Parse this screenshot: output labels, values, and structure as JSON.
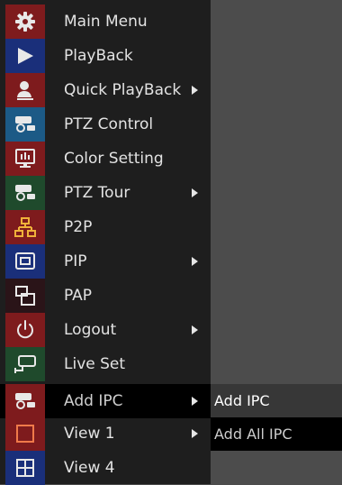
{
  "menu": {
    "items": [
      {
        "label": "Main Menu",
        "icon": "gear-icon",
        "icon_bg": "#7e1b1d",
        "has_submenu": false
      },
      {
        "label": "PlayBack",
        "icon": "play-icon",
        "icon_bg": "#1a2f7a",
        "has_submenu": false
      },
      {
        "label": "Quick PlayBack",
        "icon": "user-icon",
        "icon_bg": "#7e1b1d",
        "has_submenu": true
      },
      {
        "label": "PTZ Control",
        "icon": "ptz-camera-icon",
        "icon_bg": "#1c5a86",
        "has_submenu": false
      },
      {
        "label": "Color Setting",
        "icon": "monitor-icon",
        "icon_bg": "#7e1b1d",
        "has_submenu": false
      },
      {
        "label": "PTZ Tour",
        "icon": "ptz-camera-icon",
        "icon_bg": "#1f4a2c",
        "has_submenu": true
      },
      {
        "label": "P2P",
        "icon": "network-icon",
        "icon_bg": "#7e1b1d",
        "has_submenu": false
      },
      {
        "label": "PIP",
        "icon": "pip-icon",
        "icon_bg": "#1a2f7a",
        "has_submenu": true
      },
      {
        "label": "PAP",
        "icon": "pap-icon",
        "icon_bg": "#2a1418",
        "has_submenu": false
      },
      {
        "label": "Logout",
        "icon": "power-icon",
        "icon_bg": "#7e1b1d",
        "has_submenu": true
      },
      {
        "label": "Live Set",
        "icon": "camera-icon",
        "icon_bg": "#1f4a2c",
        "has_submenu": false
      },
      {
        "label": "Add IPC",
        "icon": "ipc-camera-icon",
        "icon_bg": "#7e1b1d",
        "has_submenu": true,
        "selected": true
      },
      {
        "label": "View 1",
        "icon": "single-view-icon",
        "icon_bg": "#7e1b1d",
        "has_submenu": true
      },
      {
        "label": "View 4",
        "icon": "quad-view-icon",
        "icon_bg": "#1a2f7a",
        "has_submenu": false
      }
    ]
  },
  "submenu": {
    "items": [
      {
        "label": "Add IPC"
      },
      {
        "label": "Add All IPC"
      }
    ]
  }
}
